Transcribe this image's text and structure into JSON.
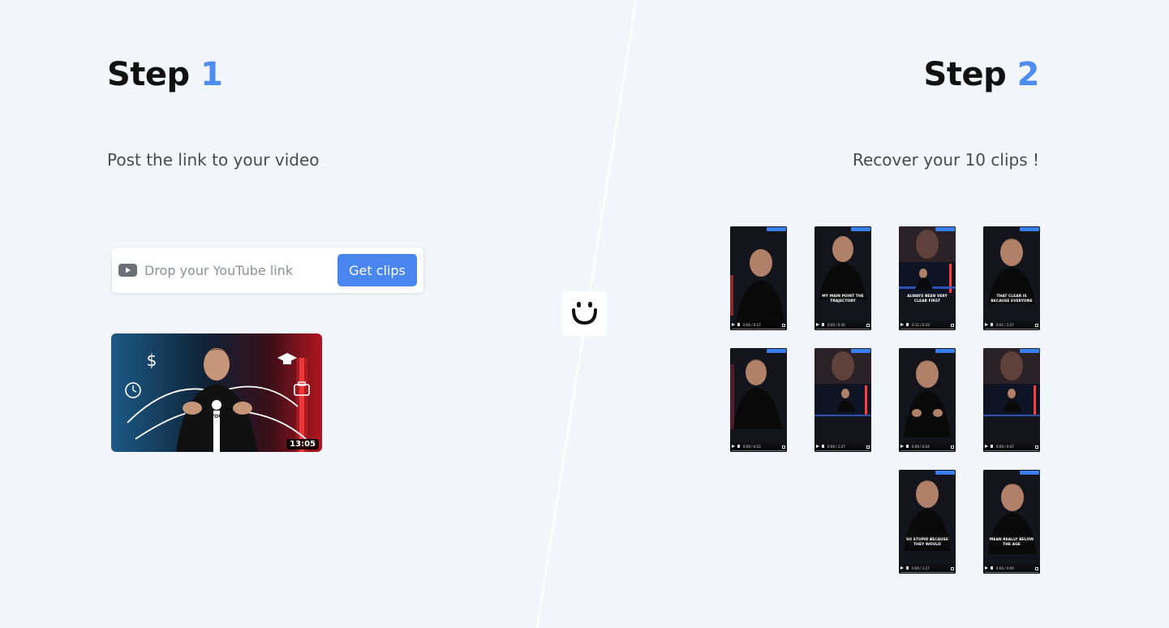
{
  "step1": {
    "word": "Step",
    "number": "1",
    "description": "Post the link to your video",
    "input_placeholder": "Drop your YouTube link",
    "button_label": "Get clips",
    "video_duration": "13:05",
    "thumb_shirt_text": "YOU"
  },
  "step2": {
    "word": "Step",
    "number": "2",
    "description": "Recover your 10 clips !",
    "clips": [
      {
        "caption": "",
        "time": "0:00 / 0:27"
      },
      {
        "caption": "My main point the trajectory",
        "time": "0:00 / 0:30"
      },
      {
        "caption": "Always been very clear first",
        "time": "0:11 / 0:33"
      },
      {
        "caption": "That clear is because everyone",
        "time": "0:01 / 1:27"
      },
      {
        "caption": "",
        "time": "0:00 / 0:22"
      },
      {
        "caption": "",
        "time": "0:00 / 1:27"
      },
      {
        "caption": "",
        "time": "0:00 / 0:24"
      },
      {
        "caption": "",
        "time": "0:00 / 0:47"
      },
      {
        "caption": "So stupid because they would",
        "time": "0:00 / 1:17"
      },
      {
        "caption": "Mean really below the age",
        "time": "0:00 / 0:00"
      }
    ]
  },
  "colors": {
    "accent": "#4e8cf0",
    "button": "#4a86ef",
    "background": "#f2f5fa"
  }
}
